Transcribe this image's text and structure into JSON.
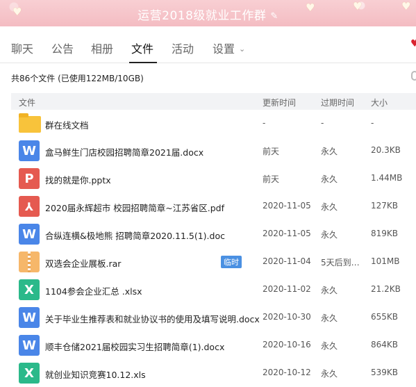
{
  "header": {
    "title": "运营2018级就业工作群"
  },
  "tabs": [
    "聊天",
    "公告",
    "相册",
    "文件",
    "活动",
    "设置"
  ],
  "summary": "共86个文件 (已使用122MB/10GB)",
  "columns": {
    "file": "文件",
    "updated": "更新时间",
    "expire": "过期时间",
    "size": "大小"
  },
  "files": [
    {
      "type": "folder",
      "name": "群在线文档",
      "updated": "-",
      "expire": "-",
      "size": "-",
      "tag": ""
    },
    {
      "type": "word",
      "icon_char": "W",
      "name": "盒马鲜生门店校园招聘简章2021届.docx",
      "updated": "前天",
      "expire": "永久",
      "size": "20.3KB",
      "tag": ""
    },
    {
      "type": "ppt",
      "icon_char": "P",
      "name": "找的就是你.pptx",
      "updated": "前天",
      "expire": "永久",
      "size": "1.44MB",
      "tag": ""
    },
    {
      "type": "pdf",
      "icon_char": "⅄",
      "name": "2020届永辉超市 校园招聘简章~江苏省区.pdf",
      "updated": "2020-11-05",
      "expire": "永久",
      "size": "127KB",
      "tag": ""
    },
    {
      "type": "word",
      "icon_char": "W",
      "name": "合纵连横&极地熊 招聘简章2020.11.5(1).doc",
      "updated": "2020-11-05",
      "expire": "永久",
      "size": "819KB",
      "tag": ""
    },
    {
      "type": "rar",
      "icon_char": "",
      "name": "双选会企业展板.rar",
      "updated": "2020-11-04",
      "expire": "5天后到…",
      "size": "101MB",
      "tag": "临时"
    },
    {
      "type": "excel",
      "icon_char": "X",
      "name": "1104参会企业汇总 .xlsx",
      "updated": "2020-11-02",
      "expire": "永久",
      "size": "21.2KB",
      "tag": ""
    },
    {
      "type": "word",
      "icon_char": "W",
      "name": "关于毕业生推荐表和就业协议书的使用及填写说明.docx",
      "updated": "2020-10-30",
      "expire": "永久",
      "size": "655KB",
      "tag": ""
    },
    {
      "type": "word",
      "icon_char": "W",
      "name": "顺丰仓储2021届校园实习生招聘简章(1).docx",
      "updated": "2020-10-16",
      "expire": "永久",
      "size": "864KB",
      "tag": ""
    },
    {
      "type": "excel",
      "icon_char": "X",
      "name": "就创业知识竞赛10.12.xls",
      "updated": "2020-10-12",
      "expire": "永久",
      "size": "539KB",
      "tag": ""
    }
  ]
}
